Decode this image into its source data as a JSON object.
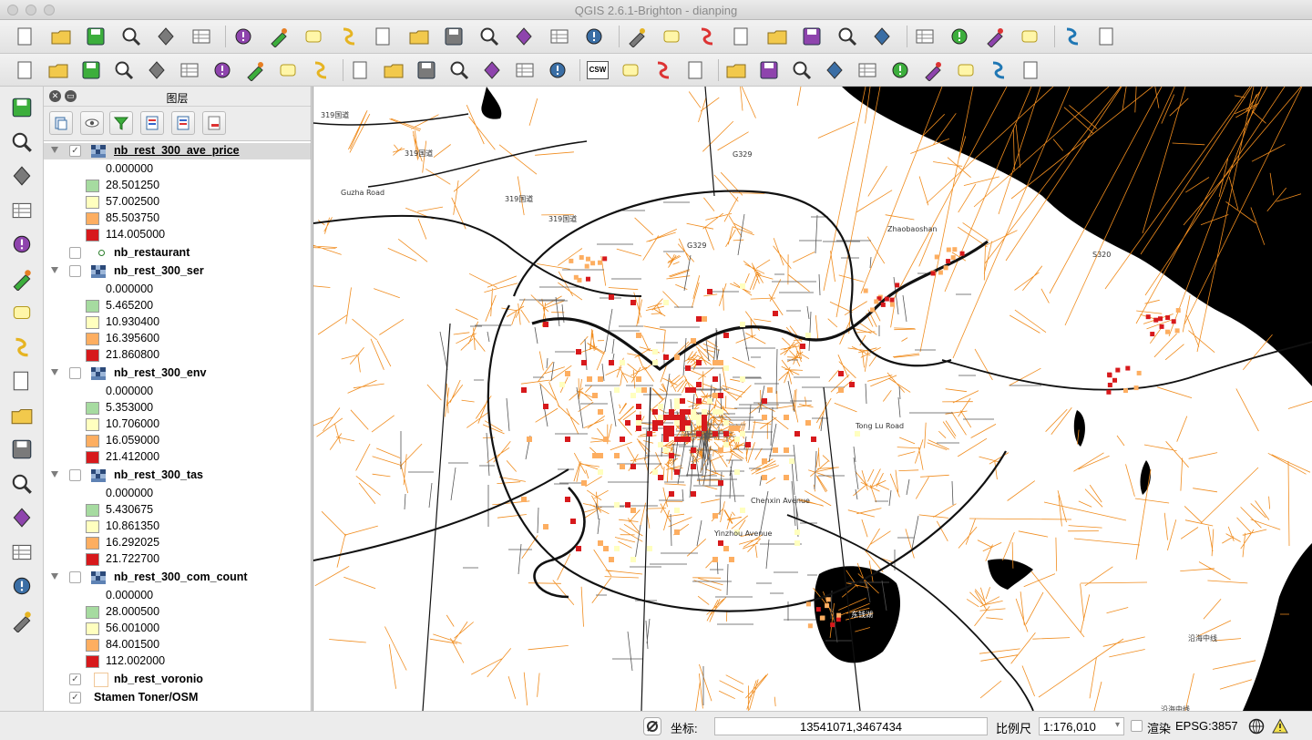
{
  "window": {
    "title": "QGIS 2.6.1-Brighton - dianping"
  },
  "toolbar_top": {
    "buttons": [
      "new-project-icon",
      "open-project-icon",
      "save-project-icon",
      "save-as-icon",
      "new-print-composer-icon",
      "composer-manager-icon",
      "pan-hand-icon",
      "pan-to-selection-icon",
      "zoom-in-icon",
      "zoom-out-icon",
      "zoom-actual-icon",
      "zoom-full-icon",
      "zoom-to-selection-icon",
      "zoom-to-layer-icon",
      "zoom-last-icon",
      "zoom-next-icon",
      "refresh-icon",
      "identify-icon",
      "run-action-icon",
      "select-features-icon",
      "deselect-icon",
      "field-calculator-icon",
      "attribute-table-icon",
      "statistics-icon",
      "measure-icon",
      "map-tips-icon",
      "new-bookmark-icon",
      "show-bookmarks-icon",
      "text-annotation-icon",
      "help-icon",
      "whats-this-icon"
    ]
  },
  "toolbar_second": {
    "buttons": [
      "current-edits-icon",
      "toggle-editing-icon",
      "save-layer-edits-icon",
      "add-feature-icon",
      "move-feature-icon",
      "node-tool-icon",
      "delete-selected-icon",
      "cut-features-icon",
      "copy-features-icon",
      "paste-features-icon",
      "label-icon",
      "pin-labels-icon",
      "highlight-pinned-icon",
      "show-hide-labels-icon",
      "move-label-icon",
      "rotate-label-icon",
      "change-label-icon",
      "csw-icon",
      "geometry-checker-icon",
      "street-view-icon",
      "zoom-tool-icon",
      "add-part-icon",
      "fill-ring-icon",
      "delete-ring-icon",
      "offset-curve-icon",
      "reshape-icon",
      "split-icon",
      "merge-icon",
      "rotate-point-icon",
      "simplify-icon",
      "add-ring-icon"
    ],
    "csw_label": "CSW"
  },
  "left_toolbar": {
    "buttons": [
      "add-vector-layer-icon",
      "add-raster-layer-icon",
      "add-postgis-layer-icon",
      "add-spatialite-layer-icon",
      "add-mssql-layer-icon",
      "add-oracle-layer-icon",
      "add-wms-layer-icon",
      "add-wcs-layer-icon",
      "add-wfs-layer-icon",
      "add-delimited-text-icon",
      "new-shapefile-icon",
      "new-spatialite-icon",
      "new-gpx-icon",
      "georeferencer-icon",
      "gps-tools-icon",
      "add-annotation-icon"
    ]
  },
  "layers_panel": {
    "title": "图层",
    "layers": [
      {
        "name": "nb_rest_300_ave_price",
        "checked": true,
        "expanded": true,
        "selected": true,
        "legend": [
          {
            "value": "0.000000",
            "color": "#ffffff"
          },
          {
            "value": "28.501250",
            "color": "#a6dba0"
          },
          {
            "value": "57.002500",
            "color": "#ffffbf"
          },
          {
            "value": "85.503750",
            "color": "#fdae61"
          },
          {
            "value": "114.005000",
            "color": "#d7191c"
          }
        ]
      },
      {
        "name": "nb_restaurant",
        "checked": false,
        "expanded": false,
        "selected": false,
        "legend": []
      },
      {
        "name": "nb_rest_300_ser",
        "checked": false,
        "expanded": true,
        "selected": false,
        "legend": [
          {
            "value": "0.000000",
            "color": "#ffffff"
          },
          {
            "value": "5.465200",
            "color": "#a6dba0"
          },
          {
            "value": "10.930400",
            "color": "#ffffbf"
          },
          {
            "value": "16.395600",
            "color": "#fdae61"
          },
          {
            "value": "21.860800",
            "color": "#d7191c"
          }
        ]
      },
      {
        "name": "nb_rest_300_env",
        "checked": false,
        "expanded": true,
        "selected": false,
        "legend": [
          {
            "value": "0.000000",
            "color": "#ffffff"
          },
          {
            "value": "5.353000",
            "color": "#a6dba0"
          },
          {
            "value": "10.706000",
            "color": "#ffffbf"
          },
          {
            "value": "16.059000",
            "color": "#fdae61"
          },
          {
            "value": "21.412000",
            "color": "#d7191c"
          }
        ]
      },
      {
        "name": "nb_rest_300_tas",
        "checked": false,
        "expanded": true,
        "selected": false,
        "legend": [
          {
            "value": "0.000000",
            "color": "#ffffff"
          },
          {
            "value": "5.430675",
            "color": "#a6dba0"
          },
          {
            "value": "10.861350",
            "color": "#ffffbf"
          },
          {
            "value": "16.292025",
            "color": "#fdae61"
          },
          {
            "value": "21.722700",
            "color": "#d7191c"
          }
        ]
      },
      {
        "name": "nb_rest_300_com_count",
        "checked": false,
        "expanded": true,
        "selected": false,
        "legend": [
          {
            "value": "0.000000",
            "color": "#ffffff"
          },
          {
            "value": "28.000500",
            "color": "#a6dba0"
          },
          {
            "value": "56.001000",
            "color": "#ffffbf"
          },
          {
            "value": "84.001500",
            "color": "#fdae61"
          },
          {
            "value": "112.002000",
            "color": "#d7191c"
          }
        ]
      },
      {
        "name": "nb_rest_voronio",
        "checked": true,
        "expanded": false,
        "selected": false,
        "legend": []
      },
      {
        "name": "Stamen Toner/OSM",
        "checked": true,
        "expanded": false,
        "selected": false,
        "legend": []
      }
    ]
  },
  "map": {
    "labels": [
      "319国道",
      "319国道",
      "Guzha Road",
      "319国道",
      "319国道",
      "G329",
      "G329",
      "Zhaobaoshan",
      "S320",
      "Tong Lu Road",
      "Chenxin Avenue",
      "东钱湖",
      "Yinzhou Avenue",
      "沿海中线",
      "沿海中线"
    ],
    "colors": {
      "voronoi": "#f08c1e",
      "roads": "#111111",
      "water": "#000000",
      "high": "#d7191c",
      "mid": "#fdae61"
    }
  },
  "statusbar": {
    "coord_label": "坐标:",
    "coord_value": "13541071,3467434",
    "scale_label": "比例尺",
    "scale_value": "1:176,010",
    "render_label": "渲染",
    "crs": "EPSG:3857"
  }
}
